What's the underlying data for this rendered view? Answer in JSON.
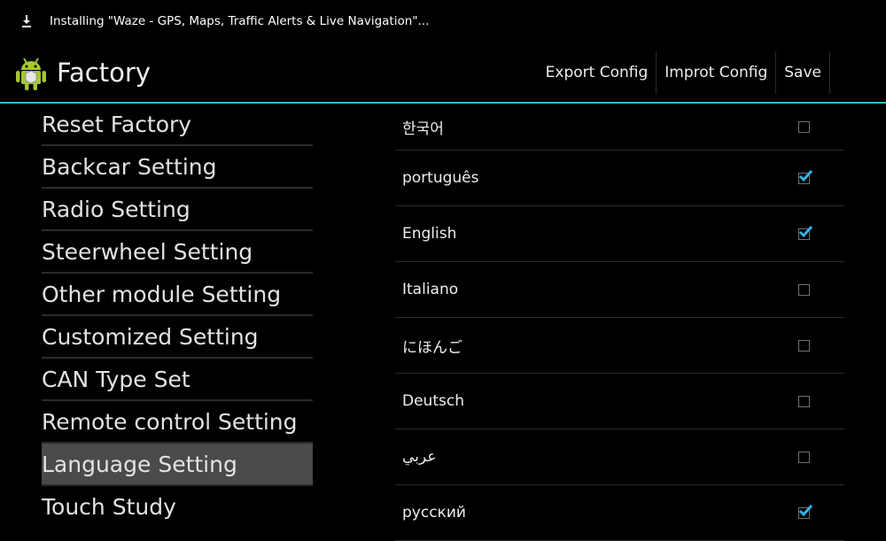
{
  "status_bar": {
    "icon": "download-icon",
    "notification": "Installing \"Waze - GPS, Maps, Traffic Alerts & Live Navigation\"..."
  },
  "action_bar": {
    "app_icon": "android-icon",
    "title": "Factory",
    "actions": [
      "Export Config",
      "Improt Config",
      "Save"
    ],
    "accent_color": "#33b5e5"
  },
  "menu": {
    "items": [
      "Reset Factory",
      "Backcar Setting",
      "Radio Setting",
      "Steerwheel Setting",
      "Other module Setting",
      "Customized Setting",
      "CAN Type Set",
      "Remote control Setting",
      "Language Setting",
      "Touch Study"
    ],
    "selected": "Language Setting"
  },
  "languages": [
    {
      "label": "한국어",
      "checked": false
    },
    {
      "label": "português",
      "checked": true
    },
    {
      "label": "English",
      "checked": true
    },
    {
      "label": "Italiano",
      "checked": false
    },
    {
      "label": "にほんご",
      "checked": false
    },
    {
      "label": "Deutsch",
      "checked": false
    },
    {
      "label": "عربي",
      "checked": false
    },
    {
      "label": "русский",
      "checked": true
    }
  ]
}
